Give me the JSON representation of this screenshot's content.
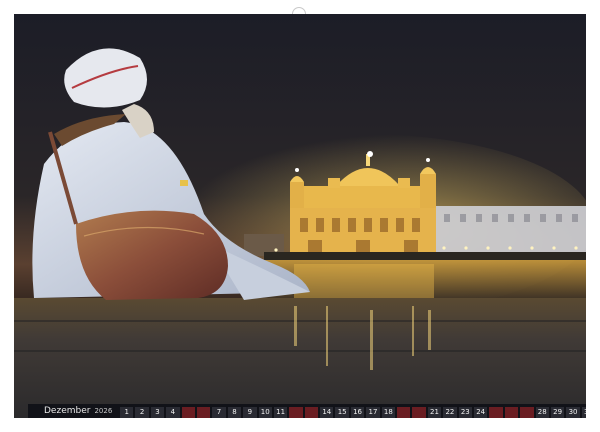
{
  "calendar": {
    "month": "Dezember",
    "year": "2026",
    "days": [
      "1",
      "2",
      "3",
      "4",
      "",
      "",
      "7",
      "8",
      "9",
      "10",
      "11",
      "",
      "",
      "14",
      "15",
      "16",
      "17",
      "18",
      "",
      "",
      "21",
      "22",
      "23",
      "24",
      "",
      "",
      "",
      "28",
      "29",
      "30",
      "31"
    ],
    "sunday_color": "#6a1d22"
  },
  "photo": {
    "subject": "night-temple-reflection"
  },
  "colors": {
    "sky": "#1e1f28",
    "gold": "#e2b34a",
    "robe": "#cfd6e6",
    "bag": "#8a4a3a"
  }
}
